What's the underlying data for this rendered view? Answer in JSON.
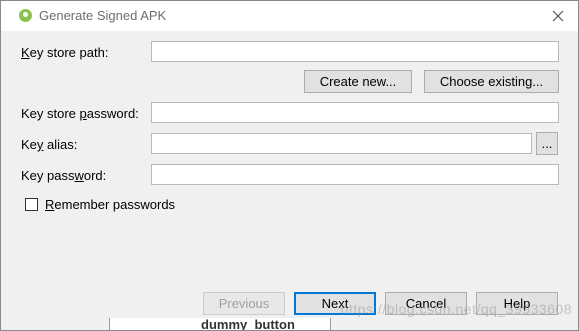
{
  "window": {
    "title": "Generate Signed APK"
  },
  "form": {
    "key_store_path": {
      "label_pre": "",
      "label_mn": "K",
      "label_post": "ey store path:",
      "value": ""
    },
    "create_new_label": "Create new...",
    "choose_existing_label": "Choose existing...",
    "key_store_password": {
      "label_pre": "Key store ",
      "label_mn": "p",
      "label_post": "assword:",
      "value": ""
    },
    "key_alias": {
      "label_pre": "Ke",
      "label_mn": "y",
      "label_post": " alias:",
      "value": ""
    },
    "browse_label": "...",
    "key_password": {
      "label_pre": "Key pass",
      "label_mn": "w",
      "label_post": "ord:",
      "value": ""
    },
    "remember": {
      "label_pre": "",
      "label_mn": "R",
      "label_post": "emember passwords",
      "checked": false
    }
  },
  "footer": {
    "previous_label": "Previous",
    "next_label": "Next",
    "cancel_label": "Cancel",
    "help_label": "Help"
  },
  "watermark": "https://blog.csdn.net/qq_39933608",
  "background_text": "dummy_button",
  "colors": {
    "dialog_bg": "#f0f0f0",
    "titlebar_bg": "#ffffff",
    "focus_border": "#0078d7",
    "app_icon": "#8cc152"
  }
}
